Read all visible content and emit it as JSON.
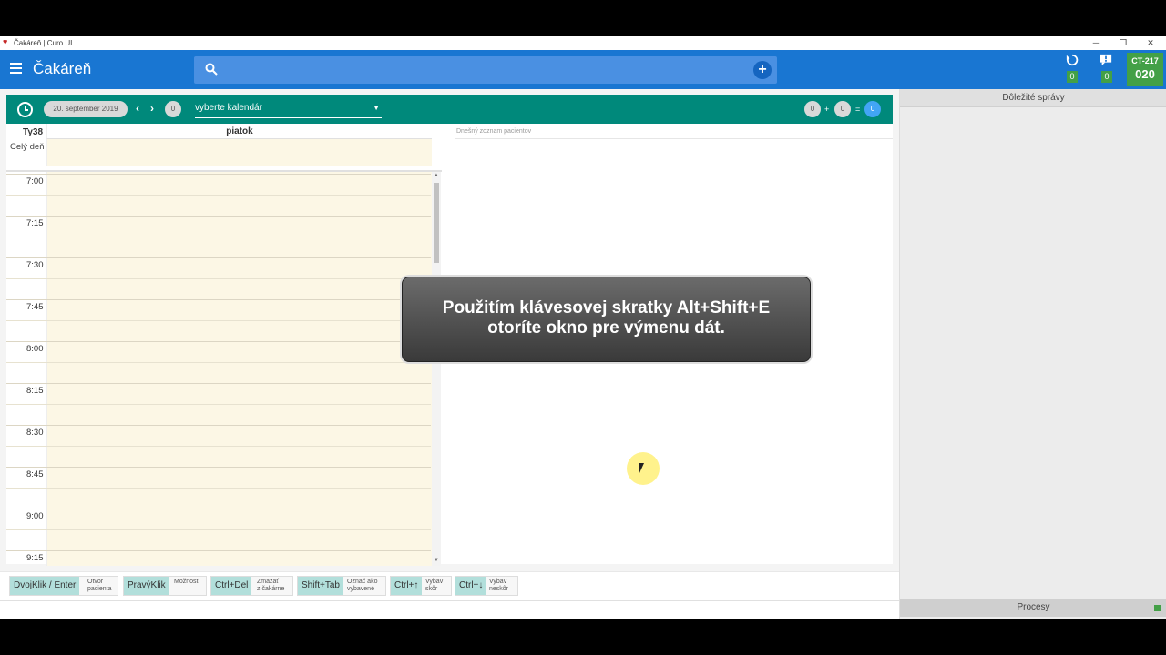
{
  "window": {
    "title": "Čakáreň | Curo UI",
    "controls": [
      "─",
      "❐",
      "✕"
    ]
  },
  "appbar": {
    "title": "Čakáreň",
    "search_placeholder": "",
    "sync_badge": "0",
    "alerts_badge": "0",
    "station": {
      "line1": "CT-217",
      "line2": "020"
    }
  },
  "toolbar": {
    "date": "20. september 2019",
    "prev": "‹",
    "next": "›",
    "count": "0",
    "calendar_select": "vyberte kalendár",
    "sum": {
      "a": "0",
      "plus": "+",
      "b": "0",
      "eq": "=",
      "total": "0"
    }
  },
  "calendar": {
    "week": "Ty38",
    "day": "piatok",
    "allday_label": "Celý deň",
    "times": [
      "7:00",
      "7:15",
      "7:30",
      "7:45",
      "8:00",
      "8:15",
      "8:30",
      "8:45",
      "9:00",
      "9:15"
    ]
  },
  "patients": {
    "label": "Dnešný zoznam pacientov"
  },
  "shortcuts": [
    {
      "key": "DvojKlik / Enter",
      "line1": "Otvor",
      "line2": "pacienta"
    },
    {
      "key": "PravýKlik",
      "line1": "Možnosti",
      "line2": ""
    },
    {
      "key": "Ctrl+Del",
      "line1": "Zmazať",
      "line2": "z čakárne"
    },
    {
      "key": "Shift+Tab",
      "line1": "Označ ako",
      "line2": "vybavené"
    },
    {
      "key": "Ctrl+↑",
      "line1": "Vybav",
      "line2": "skôr"
    },
    {
      "key": "Ctrl+↓",
      "line1": "Vybav",
      "line2": "neskôr"
    }
  ],
  "right_panel": {
    "header": "Dôležité správy",
    "footer": "Procesy"
  },
  "toast": {
    "line1": "Použitím klávesovej skratky Alt+Shift+E",
    "line2": "otoríte okno pre výmenu dát."
  },
  "colors": {
    "appbar": "#1976d2",
    "toolbar": "#00897b",
    "badge": "#43a047",
    "calendar_bg": "#fcf7e5"
  }
}
